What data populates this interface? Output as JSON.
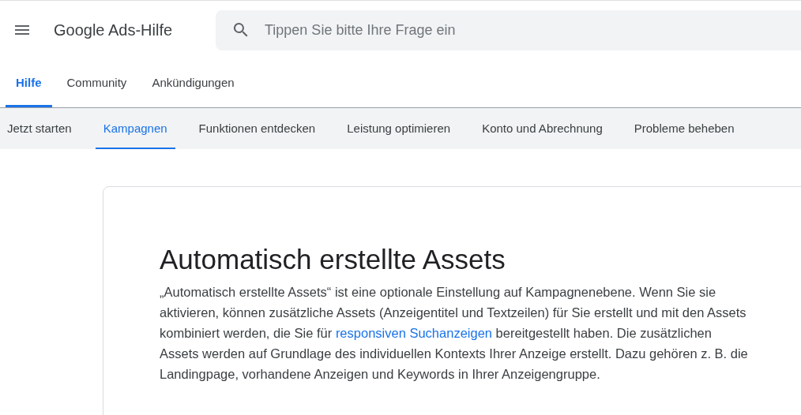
{
  "header": {
    "title": "Google Ads-Hilfe",
    "search": {
      "placeholder": "Tippen Sie bitte Ihre Frage ein"
    }
  },
  "tabs": [
    {
      "label": "Hilfe",
      "selected": true
    },
    {
      "label": "Community",
      "selected": false
    },
    {
      "label": "Ankündigungen",
      "selected": false
    }
  ],
  "nav": [
    {
      "label": "Jetzt starten",
      "selected": false
    },
    {
      "label": "Kampagnen",
      "selected": true
    },
    {
      "label": "Funktionen entdecken",
      "selected": false
    },
    {
      "label": "Leistung optimieren",
      "selected": false
    },
    {
      "label": "Konto und Abrechnung",
      "selected": false
    },
    {
      "label": "Probleme beheben",
      "selected": false
    }
  ],
  "article": {
    "title": "Automatisch erstellte Assets",
    "paragraph": {
      "before": "„Automatisch erstellte Assets“ ist eine optionale Einstellung auf Kampagnenebene. Wenn Sie sie aktivieren, können zusätzliche Assets (Anzeigentitel und Textzeilen) für Sie erstellt und mit den Assets kombiniert werden, die Sie für",
      "link": "responsiven Suchanzeigen",
      "after": "bereitgestellt haben. Die zusätzlichen Assets werden auf Grundlage des individuellen Kontexts Ihrer Anzeige erstellt. Dazu gehören z. B. die Landingpage, vorhandene Anzeigen und Keywords in Ihrer Anzeigengruppe."
    }
  }
}
